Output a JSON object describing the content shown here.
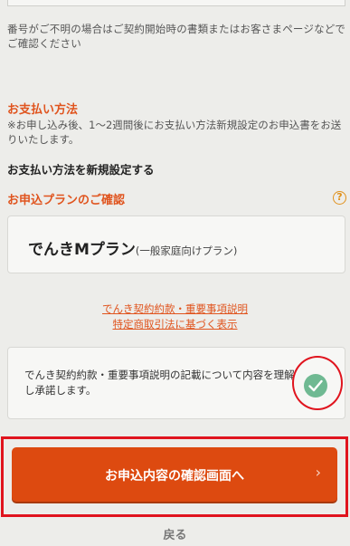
{
  "account_note": "番号がご不明の場合はご契約開始時の書類またはお客さまページなどでご確認ください",
  "payment": {
    "heading": "お支払い方法",
    "note": "※お申し込み後、1〜2週間後にお支払い方法新規設定のお申込書をお送りいたします。",
    "method": "お支払い方法を新規設定する"
  },
  "plan": {
    "heading": "お申込プランのご確認",
    "help_icon": "?",
    "name": "でんきMプラン",
    "sub": "(一般家庭向けプラン)"
  },
  "links": [
    "でんき契約約款・重要事項説明",
    "特定商取引法に基づく表示"
  ],
  "consent": {
    "text": "でんき契約約款・重要事項説明の記載について内容を理解し承諾します。",
    "checked": true,
    "check_color": "#6fb992"
  },
  "confirm_button": {
    "label": "お申込内容の確認画面へ",
    "chevron": "›"
  },
  "back_label": "戻る",
  "colors": {
    "accent": "#e0541e",
    "button": "#dd4a10",
    "annotation": "#e0141e"
  }
}
